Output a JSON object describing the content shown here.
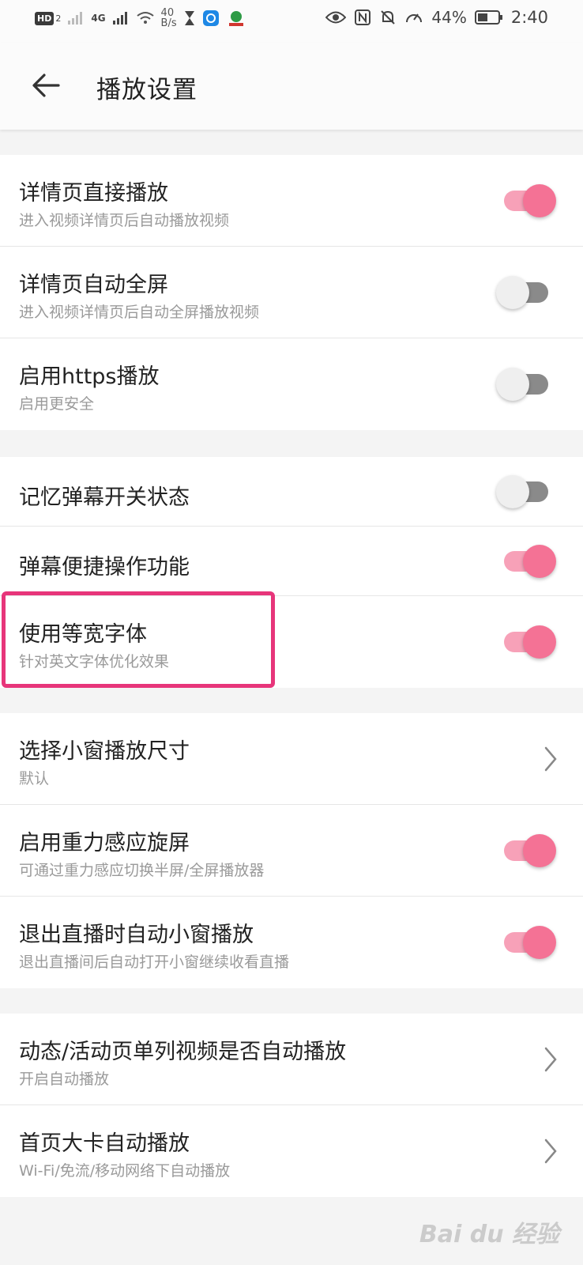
{
  "status": {
    "carrier_chip": "HD",
    "sim_slot": "2",
    "network": "4G",
    "net_speed_value": "40",
    "net_speed_unit": "B/s",
    "battery": "44%",
    "time": "2:40"
  },
  "header": {
    "title": "播放设置"
  },
  "groups": [
    {
      "rows": [
        {
          "title": "详情页直接播放",
          "subtitle": "进入视频详情页后自动播放视频",
          "control": "toggle",
          "on": true
        },
        {
          "title": "详情页自动全屏",
          "subtitle": "进入视频详情页后自动全屏播放视频",
          "control": "toggle",
          "on": false
        },
        {
          "title": "启用https播放",
          "subtitle": "启用更安全",
          "control": "toggle",
          "on": false
        }
      ]
    },
    {
      "rows": [
        {
          "title": "记忆弹幕开关状态",
          "control": "toggle",
          "on": false
        },
        {
          "title": "弹幕便捷操作功能",
          "control": "toggle",
          "on": true
        },
        {
          "title": "使用等宽字体",
          "subtitle": "针对英文字体优化效果",
          "control": "toggle",
          "on": true
        }
      ]
    },
    {
      "rows": [
        {
          "title": "选择小窗播放尺寸",
          "subtitle": "默认",
          "control": "chevron"
        },
        {
          "title": "启用重力感应旋屏",
          "subtitle": "可通过重力感应切换半屏/全屏播放器",
          "control": "toggle",
          "on": true
        },
        {
          "title": "退出直播时自动小窗播放",
          "subtitle": "退出直播间后自动打开小窗继续收看直播",
          "control": "toggle",
          "on": true
        }
      ]
    },
    {
      "rows": [
        {
          "title": "动态/活动页单列视频是否自动播放",
          "subtitle": "开启自动播放",
          "control": "chevron"
        },
        {
          "title": "首页大卡自动播放",
          "subtitle": "Wi-Fi/免流/移动网络下自动播放",
          "control": "chevron"
        }
      ]
    }
  ],
  "colors": {
    "accent": "#f47295",
    "accent_track": "#f7a1b8",
    "highlight": "#e7357a"
  },
  "watermark": "Bai du 经验"
}
